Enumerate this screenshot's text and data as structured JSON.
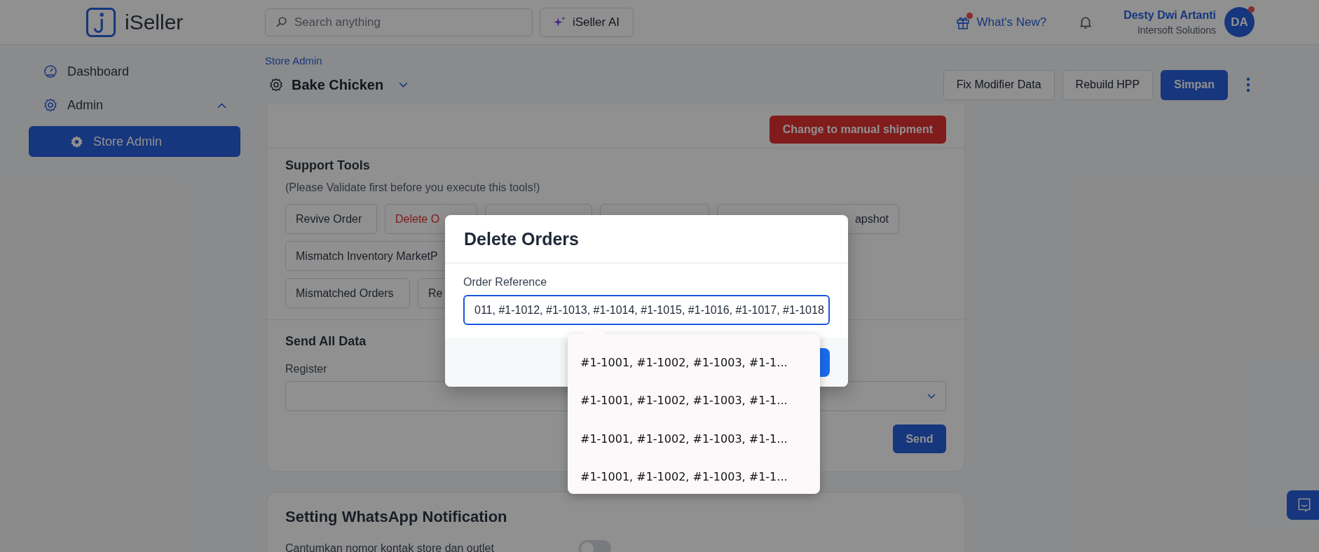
{
  "header": {
    "logo_text": "iSeller",
    "search": {
      "placeholder": "Search anything"
    },
    "ai_button": "iSeller AI",
    "whats_new": {
      "label": "What's New?",
      "has_dot": true
    },
    "user": {
      "name": "Desty Dwi Artanti",
      "company": "Intersoft Solutions",
      "initials": "DA",
      "has_dot": true
    }
  },
  "sidebar": {
    "items": [
      {
        "label": "Dashboard",
        "selected": false
      },
      {
        "label": "Admin",
        "selected": false,
        "expanded": true,
        "children": [
          {
            "label": "Store Admin",
            "selected": true
          }
        ]
      }
    ]
  },
  "page": {
    "breadcrumb": "Store Admin",
    "title": "Bake Chicken",
    "actions": [
      {
        "label": "Fix Modifier Data",
        "kind": "secondary"
      },
      {
        "label": "Rebuild HPP",
        "kind": "secondary"
      },
      {
        "label": "Simpan",
        "kind": "primary"
      }
    ]
  },
  "shipment_button": "Change to manual shipment",
  "support_tools": {
    "title": "Support Tools",
    "note": "(Please Validate first before you execute this tools!)",
    "rows": [
      [
        {
          "label": "Revive Order",
          "kind": "normal"
        },
        {
          "label": "Delete O",
          "kind": "danger"
        },
        {
          "kind": "covered"
        },
        {
          "kind": "covered"
        },
        {
          "label": "apshot",
          "kind": "tail"
        }
      ],
      [
        {
          "label": "Mismatch Inventory MarketP",
          "kind": "normal"
        }
      ],
      [
        {
          "label": "Mismatched Orders",
          "kind": "normal"
        },
        {
          "label": "Re",
          "kind": "normal"
        }
      ]
    ]
  },
  "send_all_data": {
    "title": "Send All Data",
    "register_label": "Register",
    "send_button": "Send"
  },
  "whatsapp": {
    "title": "Setting WhatsApp Notification",
    "option": "Cantumkan nomor kontak store dan outlet",
    "on": false
  },
  "modal": {
    "title": "Delete Orders",
    "field_label": "Order Reference",
    "field_value": "011, #1-1012, #1-1013, #1-1014, #1-1015, #1-1016, #1-1017, #1-1018",
    "suggestions": [
      "#1-1001, #1-1002, #1-1003, #1-1...",
      "#1-1001, #1-1002, #1-1003, #1-1...",
      "#1-1001, #1-1002, #1-1003, #1-1...",
      "#1-1001, #1-1002, #1-1003, #1-1..."
    ]
  }
}
